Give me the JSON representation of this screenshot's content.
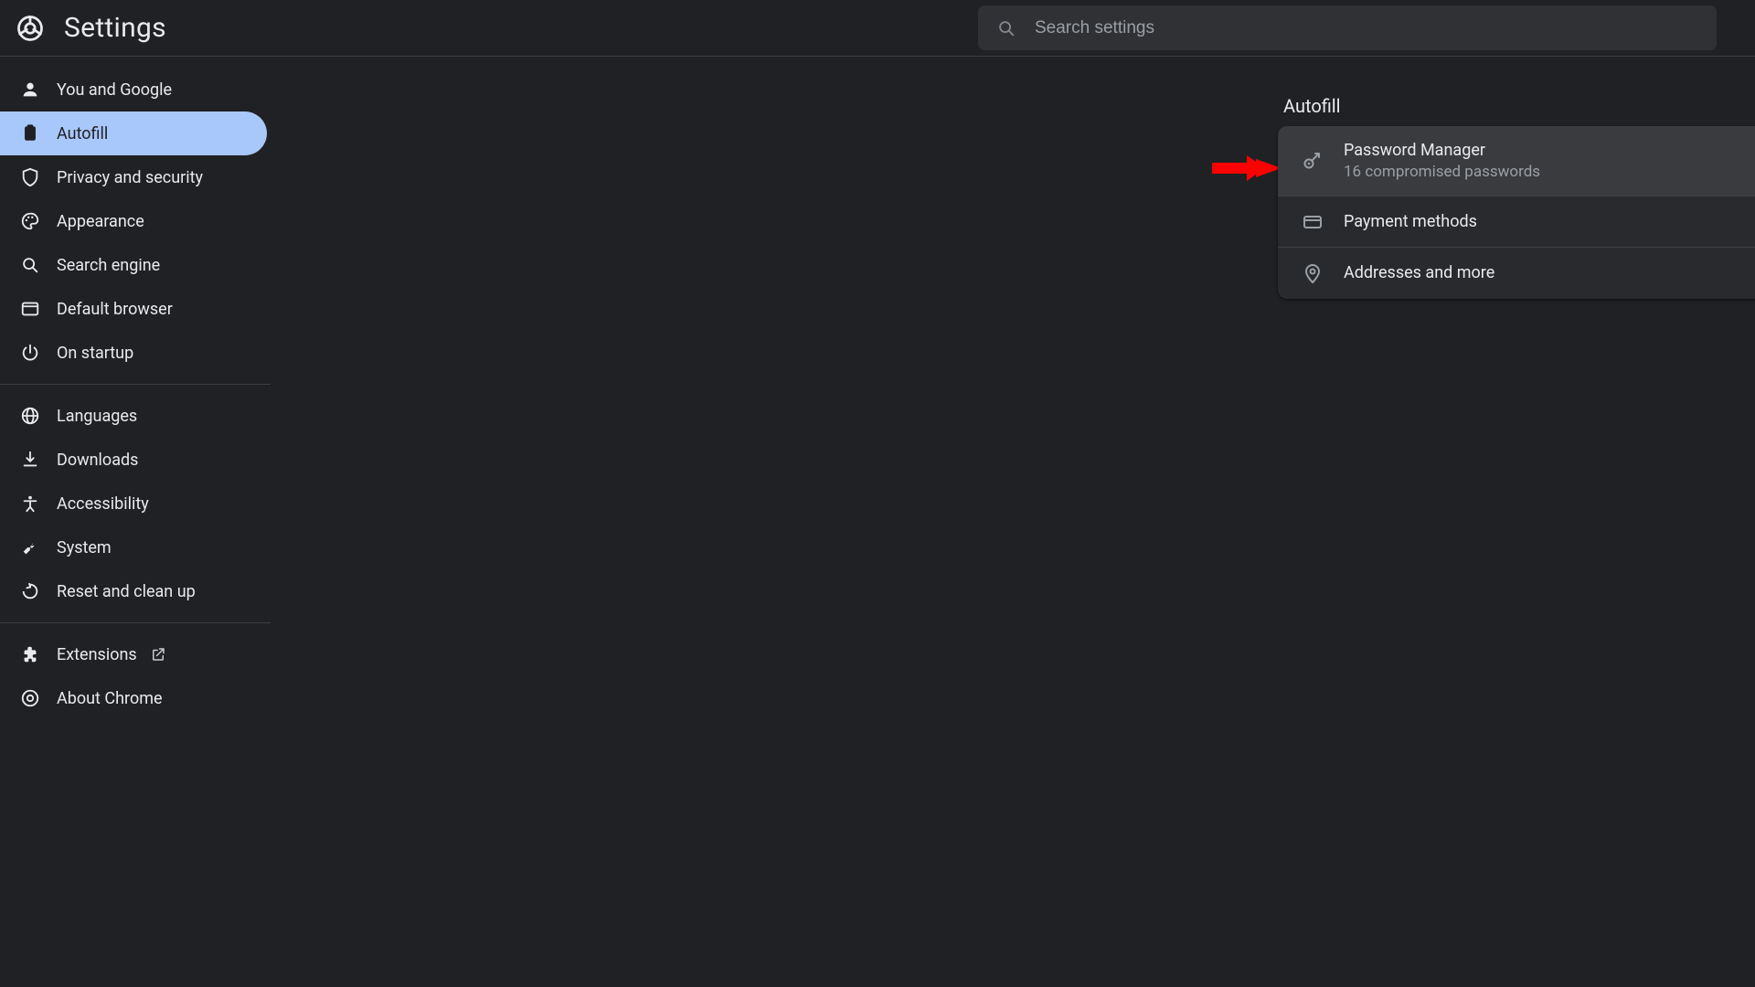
{
  "header": {
    "title": "Settings"
  },
  "search": {
    "placeholder": "Search settings",
    "value": ""
  },
  "sidebar": {
    "groups": [
      [
        {
          "id": "you-and-google",
          "label": "You and Google"
        },
        {
          "id": "autofill",
          "label": "Autofill",
          "active": true
        },
        {
          "id": "privacy-and-security",
          "label": "Privacy and security"
        },
        {
          "id": "appearance",
          "label": "Appearance"
        },
        {
          "id": "search-engine",
          "label": "Search engine"
        },
        {
          "id": "default-browser",
          "label": "Default browser"
        },
        {
          "id": "on-startup",
          "label": "On startup"
        }
      ],
      [
        {
          "id": "languages",
          "label": "Languages"
        },
        {
          "id": "downloads",
          "label": "Downloads"
        },
        {
          "id": "accessibility",
          "label": "Accessibility"
        },
        {
          "id": "system",
          "label": "System"
        },
        {
          "id": "reset",
          "label": "Reset and clean up"
        }
      ],
      [
        {
          "id": "extensions",
          "label": "Extensions",
          "external": true
        },
        {
          "id": "about-chrome",
          "label": "About Chrome"
        }
      ]
    ]
  },
  "main": {
    "section_title": "Autofill",
    "rows": [
      {
        "id": "password-manager",
        "title": "Password Manager",
        "subtitle": "16 compromised passwords",
        "hovered": true
      },
      {
        "id": "payment-methods",
        "title": "Payment methods"
      },
      {
        "id": "addresses",
        "title": "Addresses and more"
      }
    ]
  },
  "annotation": {
    "arrow_points_to": "password-manager"
  },
  "colors": {
    "bg": "#202124",
    "card": "#292a2d",
    "hover": "#3a3b3e",
    "active": "#a8c7fa",
    "divider": "#3c4043",
    "muted": "#9aa0a6",
    "annotation": "#ff0000"
  }
}
